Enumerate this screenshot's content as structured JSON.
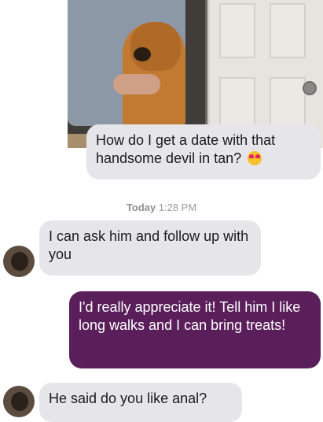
{
  "conversation": {
    "messages": [
      {
        "text": "How do I get a date with that handsome devil in tan?",
        "emoji": "heart-eyes"
      },
      {
        "text": "I can ask him and follow up with you"
      },
      {
        "text": "I'd really appreciate it! Tell him I like long walks and I can bring treats!"
      },
      {
        "text": "He said do you like anal?"
      }
    ],
    "timestamp": {
      "day": "Today",
      "time": "1:28 PM"
    }
  },
  "colors": {
    "incoming_bubble": "#e6e5ea",
    "outgoing_bubble": "#5a1f5b",
    "timestamp": "#9a9aa0"
  }
}
